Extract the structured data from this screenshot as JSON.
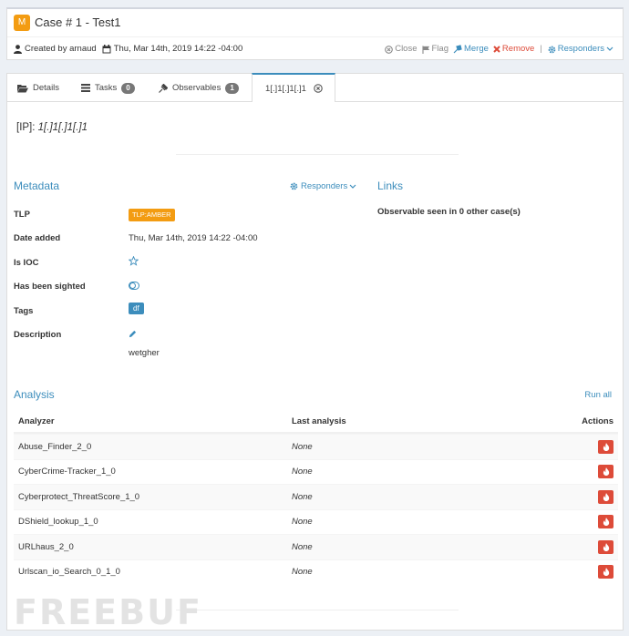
{
  "case": {
    "badge": "M",
    "title": "Case # 1 - Test1",
    "created_by": "Created by arnaud",
    "date": "Thu, Mar 14th, 2019 14:22 -04:00",
    "actions": {
      "close": "Close",
      "flag": "Flag",
      "merge": "Merge",
      "remove": "Remove",
      "responders": "Responders"
    }
  },
  "tabs": [
    {
      "label": "Details"
    },
    {
      "label": "Tasks",
      "count": "0"
    },
    {
      "label": "Observables",
      "count": "1"
    },
    {
      "label": "1[.]1[.]1[.]1"
    }
  ],
  "observable": {
    "type_label": "[IP]:",
    "value": "1[.]1[.]1[.]1"
  },
  "metadata": {
    "title": "Metadata",
    "responders": "Responders",
    "tlp_label": "TLP",
    "tlp_value": "TLP:AMBER",
    "date_label": "Date added",
    "date_value": "Thu, Mar 14th, 2019 14:22 -04:00",
    "ioc_label": "Is IOC",
    "sighted_label": "Has been sighted",
    "tags_label": "Tags",
    "tag_value": "df",
    "description_label": "Description",
    "description_value": "wetgher"
  },
  "links": {
    "title": "Links",
    "text": "Observable seen in 0 other case(s)"
  },
  "analysis": {
    "title": "Analysis",
    "run_all": "Run all",
    "headers": {
      "analyzer": "Analyzer",
      "last": "Last analysis",
      "actions": "Actions"
    },
    "rows": [
      {
        "name": "Abuse_Finder_2_0",
        "last": "None"
      },
      {
        "name": "CyberCrime-Tracker_1_0",
        "last": "None"
      },
      {
        "name": "Cyberprotect_ThreatScore_1_0",
        "last": "None"
      },
      {
        "name": "DShield_lookup_1_0",
        "last": "None"
      },
      {
        "name": "URLhaus_2_0",
        "last": "None"
      },
      {
        "name": "Urlscan_io_Search_0_1_0",
        "last": "None"
      }
    ]
  },
  "watermark": "FREEBUF",
  "colors": {
    "accent": "#3c8dbc",
    "warning": "#f39c12",
    "danger": "#dd4b39"
  }
}
